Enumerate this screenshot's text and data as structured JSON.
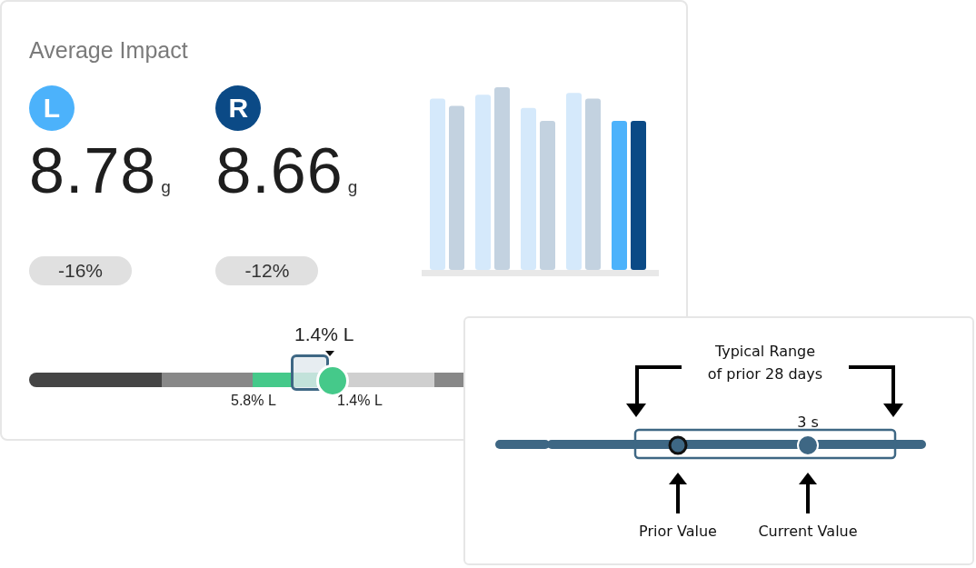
{
  "impact_card": {
    "title": "Average Impact",
    "sides": [
      {
        "badge": "L",
        "color": "#4cb2fb",
        "value": "8.78",
        "unit": "g",
        "change": "-16%"
      },
      {
        "badge": "R",
        "color": "#0b4a86",
        "value": "8.66",
        "unit": "g",
        "change": "-12%"
      }
    ],
    "meter": {
      "marker_label": "1.4% L",
      "range_low_label": "5.8% L",
      "range_high_label": "1.4% L"
    }
  },
  "legend_card": {
    "range_caption": [
      "Typical Range",
      "of prior 28 days"
    ],
    "current_reading": "3 s",
    "prior_label": "Prior Value",
    "current_label": "Current Value"
  }
}
